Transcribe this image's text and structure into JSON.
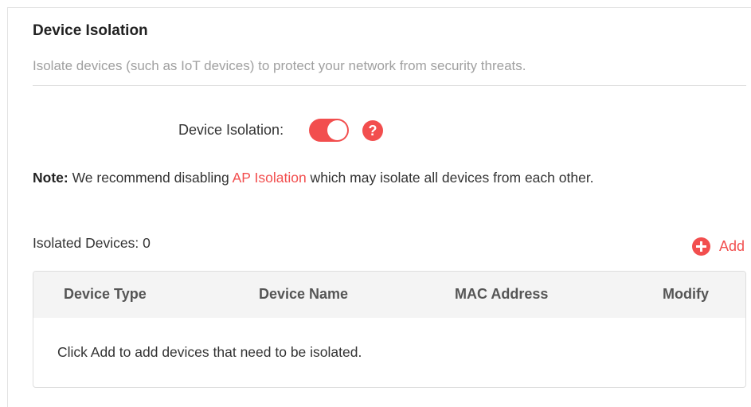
{
  "section": {
    "title": "Device Isolation",
    "description": "Isolate devices (such as IoT devices) to protect your network from security threats."
  },
  "setting": {
    "label": "Device Isolation:",
    "toggle_state": "on",
    "accent_color": "#f24e4e",
    "help_icon_glyph": "?"
  },
  "note": {
    "prefix": "Note:",
    "text_before": " We recommend disabling ",
    "link": "AP Isolation",
    "text_after": " which may isolate all devices from each other."
  },
  "isolated": {
    "count_label": "Isolated Devices: 0",
    "add_label": "Add"
  },
  "table": {
    "columns": [
      "Device Type",
      "Device Name",
      "MAC Address",
      "Modify"
    ],
    "empty_message": "Click Add to add devices that need to be isolated."
  }
}
